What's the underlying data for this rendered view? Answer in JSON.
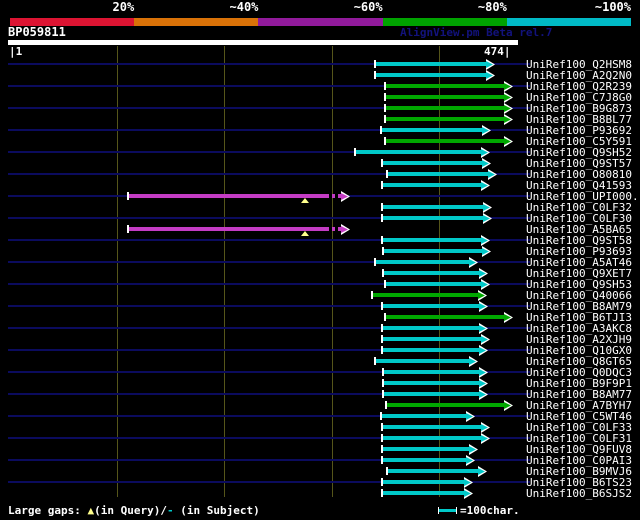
{
  "header": {
    "query_title": "BP059811",
    "watermark": "AlignView.pm Beta rel.7"
  },
  "ruler": {
    "start_label": "|1",
    "end_label": "474|"
  },
  "footer": {
    "prefix": "Large gaps: ",
    "query_marker": "▲",
    "query_text": "(in Query)/",
    "subject_marker": "-",
    "subject_text": " (in Subject)",
    "scale_label": "=100char."
  },
  "colors": {
    "bar_cyan": "#00c9c9",
    "bar_green": "#00a800",
    "bar_magenta": "#c43cc4",
    "row_line": "#0b0b5e",
    "gridline": "#55551a",
    "gap_triangle": "#ffff8c"
  },
  "chart_data": {
    "type": "alignment-bar-map",
    "title": "BP059811",
    "query_length": 474,
    "x_axis": {
      "min": 1,
      "max": 474,
      "gridline_interval_chars": 100
    },
    "identity_scale": [
      {
        "label": "20%",
        "color": "#dc1432"
      },
      {
        "label": "~40%",
        "color": "#d97208"
      },
      {
        "label": "~60%",
        "color": "#911a9b"
      },
      {
        "label": "~80%",
        "color": "#00a300"
      },
      {
        "label": "~100%",
        "color": "#00bac6"
      }
    ],
    "bucket_colors": {
      "cyan": "#00c9c9",
      "green": "#00a800",
      "magenta": "#c43cc4"
    },
    "hits": [
      {
        "subject": "UniRef100_Q2HSM8",
        "query_start": 341,
        "query_end": 453,
        "bucket": "cyan"
      },
      {
        "subject": "UniRef100_A2Q2N0",
        "query_start": 341,
        "query_end": 453,
        "bucket": "cyan"
      },
      {
        "subject": "UniRef100_Q2R239",
        "query_start": 350,
        "query_end": 469,
        "bucket": "green"
      },
      {
        "subject": "UniRef100_C7J8G0",
        "query_start": 350,
        "query_end": 469,
        "bucket": "green"
      },
      {
        "subject": "UniRef100_B9G873",
        "query_start": 350,
        "query_end": 469,
        "bucket": "green"
      },
      {
        "subject": "UniRef100_B8BL77",
        "query_start": 350,
        "query_end": 469,
        "bucket": "green"
      },
      {
        "subject": "UniRef100_P93692",
        "query_start": 346,
        "query_end": 449,
        "bucket": "cyan"
      },
      {
        "subject": "UniRef100_C5Y591",
        "query_start": 350,
        "query_end": 469,
        "bucket": "green"
      },
      {
        "subject": "UniRef100_Q9SH52",
        "query_start": 322,
        "query_end": 448,
        "bucket": "cyan"
      },
      {
        "subject": "UniRef100_Q9ST57",
        "query_start": 347,
        "query_end": 449,
        "bucket": "cyan"
      },
      {
        "subject": "UniRef100_O80810",
        "query_start": 352,
        "query_end": 454,
        "bucket": "cyan"
      },
      {
        "subject": "UniRef100_Q41593",
        "query_start": 347,
        "query_end": 448,
        "bucket": "cyan"
      },
      {
        "subject": "UniRef100_UPI000..",
        "query_start": 110,
        "query_end": 317,
        "bucket": "magenta",
        "query_gap_at": 275,
        "subject_gap_at": 298
      },
      {
        "subject": "UniRef100_C0LF32",
        "query_start": 347,
        "query_end": 450,
        "bucket": "cyan"
      },
      {
        "subject": "UniRef100_C0LF30",
        "query_start": 347,
        "query_end": 450,
        "bucket": "cyan"
      },
      {
        "subject": "UniRef100_A5BA65",
        "query_start": 110,
        "query_end": 317,
        "bucket": "magenta",
        "query_gap_at": 275,
        "subject_gap_at": 298
      },
      {
        "subject": "UniRef100_Q9ST58",
        "query_start": 347,
        "query_end": 448,
        "bucket": "cyan"
      },
      {
        "subject": "UniRef100_P93693",
        "query_start": 348,
        "query_end": 449,
        "bucket": "cyan"
      },
      {
        "subject": "UniRef100_A5AT46",
        "query_start": 341,
        "query_end": 437,
        "bucket": "cyan"
      },
      {
        "subject": "UniRef100_Q9XET7",
        "query_start": 348,
        "query_end": 446,
        "bucket": "cyan"
      },
      {
        "subject": "UniRef100_Q9SH53",
        "query_start": 350,
        "query_end": 448,
        "bucket": "cyan"
      },
      {
        "subject": "UniRef100_Q40066",
        "query_start": 338,
        "query_end": 445,
        "bucket": "green"
      },
      {
        "subject": "UniRef100_B8AM79",
        "query_start": 347,
        "query_end": 446,
        "bucket": "cyan"
      },
      {
        "subject": "UniRef100_B6TJI3",
        "query_start": 350,
        "query_end": 469,
        "bucket": "green"
      },
      {
        "subject": "UniRef100_A3AKC8",
        "query_start": 347,
        "query_end": 446,
        "bucket": "cyan"
      },
      {
        "subject": "UniRef100_A2XJH9",
        "query_start": 347,
        "query_end": 448,
        "bucket": "cyan"
      },
      {
        "subject": "UniRef100_Q10GX0",
        "query_start": 347,
        "query_end": 446,
        "bucket": "cyan"
      },
      {
        "subject": "UniRef100_Q8GT65",
        "query_start": 341,
        "query_end": 437,
        "bucket": "cyan"
      },
      {
        "subject": "UniRef100_Q0DQC3",
        "query_start": 348,
        "query_end": 446,
        "bucket": "cyan"
      },
      {
        "subject": "UniRef100_B9F9P1",
        "query_start": 348,
        "query_end": 446,
        "bucket": "cyan"
      },
      {
        "subject": "UniRef100_B8AM77",
        "query_start": 348,
        "query_end": 446,
        "bucket": "cyan"
      },
      {
        "subject": "UniRef100_A7BYH7",
        "query_start": 351,
        "query_end": 469,
        "bucket": "green"
      },
      {
        "subject": "UniRef100_C5WT46",
        "query_start": 346,
        "query_end": 434,
        "bucket": "cyan"
      },
      {
        "subject": "UniRef100_C0LF33",
        "query_start": 347,
        "query_end": 448,
        "bucket": "cyan"
      },
      {
        "subject": "UniRef100_C0LF31",
        "query_start": 347,
        "query_end": 448,
        "bucket": "cyan"
      },
      {
        "subject": "UniRef100_Q9FUV8",
        "query_start": 347,
        "query_end": 437,
        "bucket": "cyan"
      },
      {
        "subject": "UniRef100_C0PAI3",
        "query_start": 347,
        "query_end": 434,
        "bucket": "cyan"
      },
      {
        "subject": "UniRef100_B9MVJ6",
        "query_start": 352,
        "query_end": 445,
        "bucket": "cyan"
      },
      {
        "subject": "UniRef100_B6TS23",
        "query_start": 347,
        "query_end": 432,
        "bucket": "cyan"
      },
      {
        "subject": "UniRef100_B6SJS2",
        "query_start": 347,
        "query_end": 432,
        "bucket": "cyan"
      }
    ]
  }
}
